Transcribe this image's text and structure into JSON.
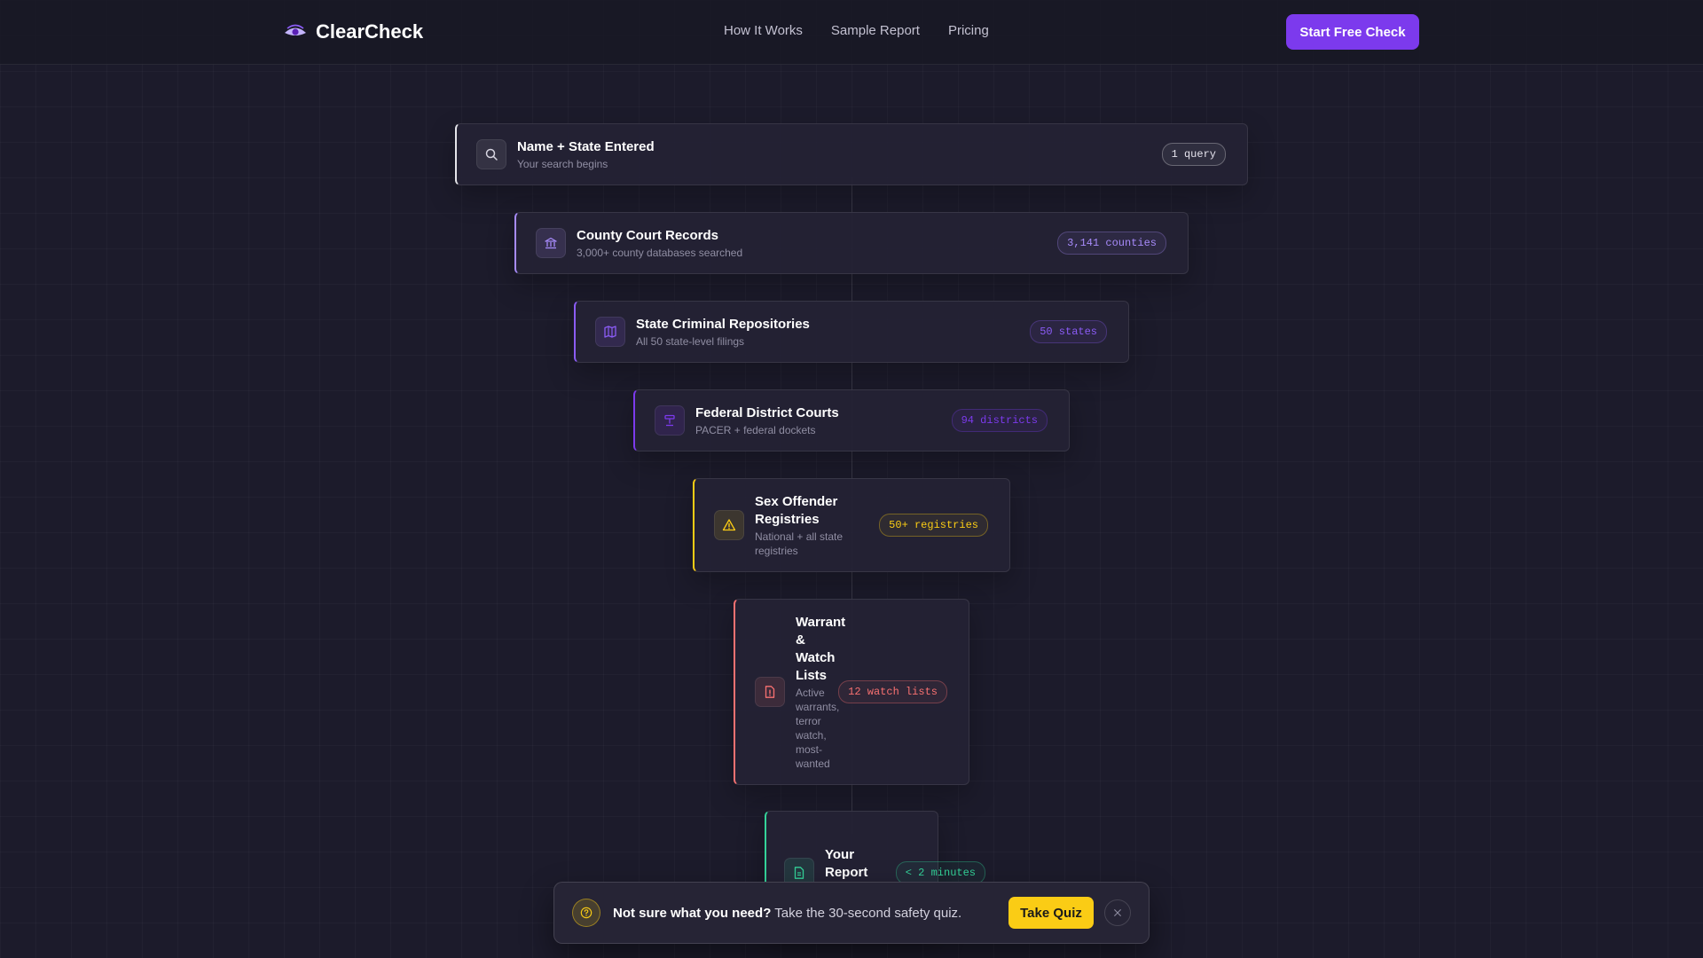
{
  "header": {
    "brand": "ClearCheck",
    "nav": [
      "How It Works",
      "Sample Report",
      "Pricing"
    ],
    "cta": "Start Free Check"
  },
  "funnel": [
    {
      "title": "Name + State Entered",
      "subtitle": "Your search begins",
      "badge": "1 query",
      "icon": "search-icon",
      "accent": "#e5e5ea"
    },
    {
      "title": "County Court Records",
      "subtitle": "3,000+ county databases searched",
      "badge": "3,141 counties",
      "icon": "building-icon",
      "accent": "#a78bfa"
    },
    {
      "title": "State Criminal Repositories",
      "subtitle": "All 50 state-level filings",
      "badge": "50 states",
      "icon": "map-icon",
      "accent": "#8b5cf6"
    },
    {
      "title": "Federal District Courts",
      "subtitle": "PACER + federal dockets",
      "badge": "94 districts",
      "icon": "gavel-icon",
      "accent": "#7c3aed"
    },
    {
      "title": "Sex Offender Registries",
      "subtitle": "National + all state registries",
      "badge": "50+ registries",
      "icon": "warning-icon",
      "accent": "#facc15"
    },
    {
      "title": "Warrant & Watch Lists",
      "subtitle": "Active warrants, terror watch, most-wanted",
      "badge": "12 watch lists",
      "icon": "alert-file-icon",
      "accent": "#f87171"
    },
    {
      "title": "Your Report Generated",
      "subtitle": "",
      "badge": "< 2 minutes",
      "icon": "document-icon",
      "accent": "#34d399"
    }
  ],
  "popup": {
    "question": "Not sure what you need?",
    "text": " Take the 30-second safety quiz.",
    "button": "Take Quiz"
  }
}
